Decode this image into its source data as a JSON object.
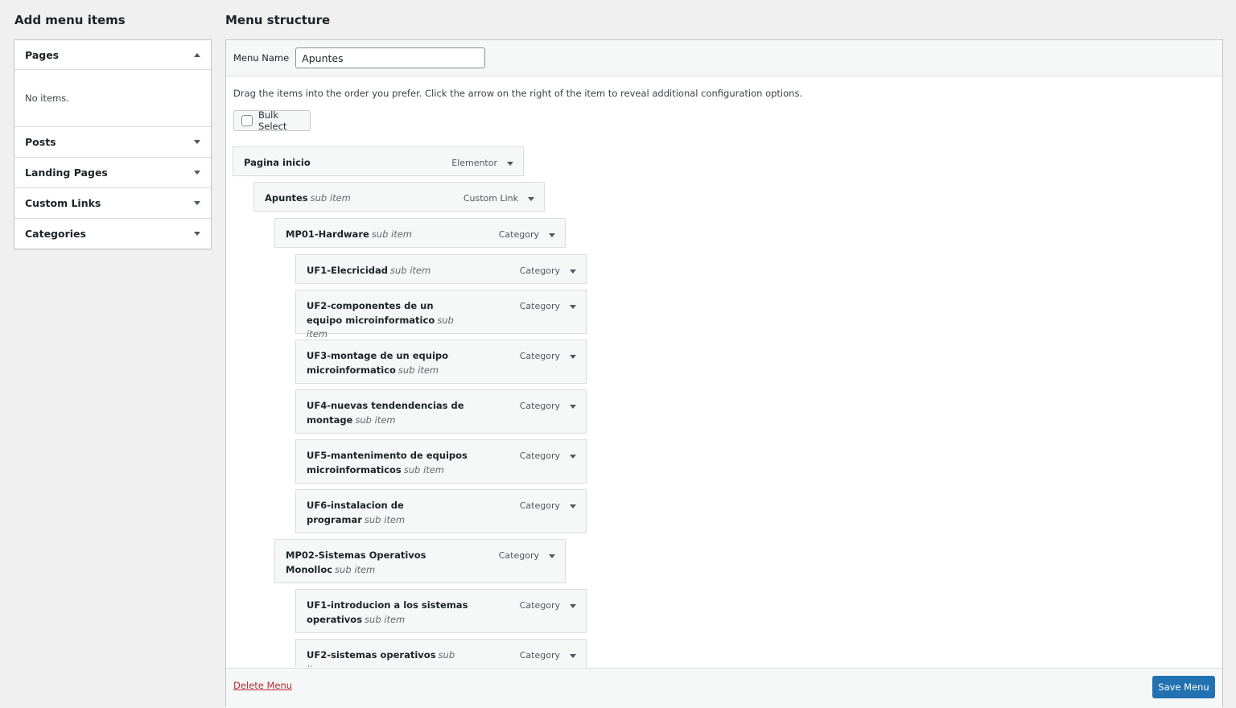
{
  "left": {
    "title": "Add menu items",
    "sections": [
      {
        "label": "Pages",
        "open": true,
        "body": "No items."
      },
      {
        "label": "Posts"
      },
      {
        "label": "Landing Pages"
      },
      {
        "label": "Custom Links"
      },
      {
        "label": "Categories"
      }
    ]
  },
  "right": {
    "title": "Menu structure",
    "menu_name_label": "Menu Name",
    "menu_name_value": "Apuntes",
    "instructions": "Drag the items into the order you prefer. Click the arrow on the right of the item to reveal additional configuration options.",
    "bulk_select": "Bulk Select",
    "items": [
      {
        "title": "Pagina inicio",
        "sub": "",
        "type": "Elementor",
        "depth": 0
      },
      {
        "title": "Apuntes",
        "sub": "sub item",
        "type": "Custom Link",
        "depth": 1
      },
      {
        "title": "MP01-Hardware",
        "sub": "sub item",
        "type": "Category",
        "depth": 2
      },
      {
        "title": "UF1-Elecricidad",
        "sub": "sub item",
        "type": "Category",
        "depth": 3
      },
      {
        "title": "UF2-componentes de un equipo microinformatico",
        "sub": "sub item",
        "type": "Category",
        "depth": 3
      },
      {
        "title": "UF3-montage de un equipo microinformatico",
        "sub": "sub item",
        "type": "Category",
        "depth": 3
      },
      {
        "title": "UF4-nuevas tendendencias de montage",
        "sub": "sub item",
        "type": "Category",
        "depth": 3
      },
      {
        "title": "UF5-mantenimento de equipos microinformaticos",
        "sub": "sub item",
        "type": "Category",
        "depth": 3
      },
      {
        "title": "UF6-instalacion de programar",
        "sub": "sub item",
        "type": "Category",
        "depth": 3
      },
      {
        "title": "MP02-Sistemas Operativos Monolloc",
        "sub": "sub item",
        "type": "Category",
        "depth": 2
      },
      {
        "title": "UF1-introducion a los sistemas operativos",
        "sub": "sub item",
        "type": "Category",
        "depth": 3
      },
      {
        "title": "UF2-sistemas operativos",
        "sub": "sub item",
        "type": "Category",
        "depth": 3
      }
    ],
    "delete_label": "Delete Menu",
    "save_label": "Save Menu"
  },
  "colors": {
    "accent": "#2271b1",
    "danger": "#b32d2e",
    "background": "#f0f0f1"
  }
}
